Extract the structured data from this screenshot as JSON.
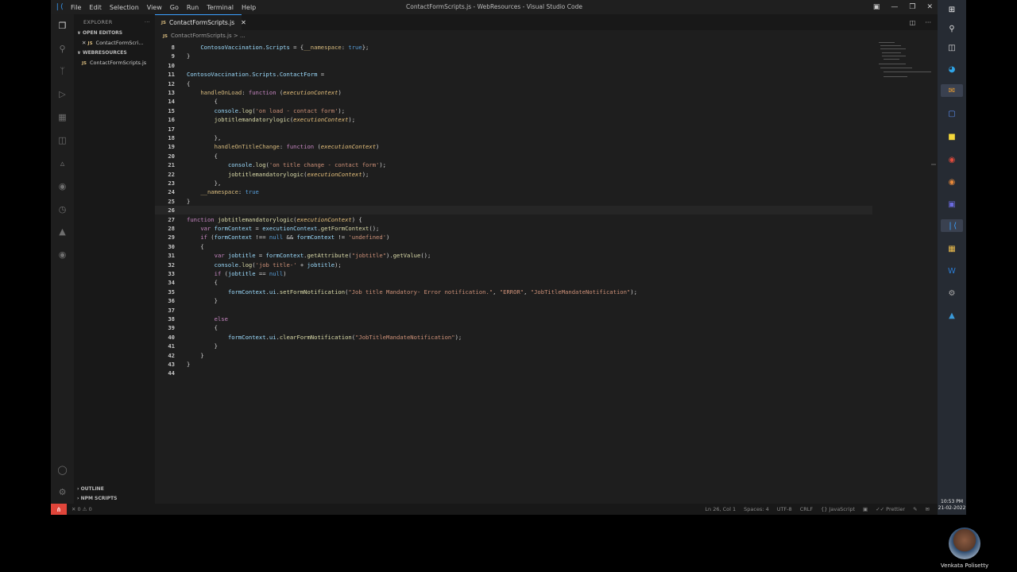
{
  "window": {
    "title": "ContactFormScripts.js - WebResources - Visual Studio Code",
    "menu": [
      "File",
      "Edit",
      "Selection",
      "View",
      "Go",
      "Run",
      "Terminal",
      "Help"
    ]
  },
  "sidebar": {
    "header": "EXPLORER",
    "open_editors_label": "OPEN EDITORS",
    "open_editor_item": "ContactFormScri...",
    "folder_label": "WEBRESOURCES",
    "folder_item": "ContactFormScripts.js",
    "outline_label": "OUTLINE",
    "npm_label": "NPM SCRIPTS"
  },
  "tab": {
    "label": "ContactFormScripts.js",
    "breadcrumb": "ContactFormScripts.js > ..."
  },
  "code_lines": [
    {
      "n": "8",
      "text": "    ContosoVaccination.Scripts = {__namespace: true};"
    },
    {
      "n": "9",
      "text": "}"
    },
    {
      "n": "10",
      "text": ""
    },
    {
      "n": "11",
      "text": "ContosoVaccination.Scripts.ContactForm ="
    },
    {
      "n": "12",
      "text": "{"
    },
    {
      "n": "13",
      "text": "    handleOnLoad: function (executionContext)"
    },
    {
      "n": "14",
      "text": "        {"
    },
    {
      "n": "15",
      "text": "        console.log('on load - contact form');"
    },
    {
      "n": "16",
      "text": "        jobtitlemandatorylogic(executionContext);"
    },
    {
      "n": "17",
      "text": ""
    },
    {
      "n": "18",
      "text": "        },"
    },
    {
      "n": "19",
      "text": "        handleOnTitleChange: function (executionContext)"
    },
    {
      "n": "20",
      "text": "        {"
    },
    {
      "n": "21",
      "text": "            console.log('on title change - contact form');"
    },
    {
      "n": "22",
      "text": "            jobtitlemandatorylogic(executionContext);"
    },
    {
      "n": "23",
      "text": "        },"
    },
    {
      "n": "24",
      "text": "    __namespace: true"
    },
    {
      "n": "25",
      "text": "}"
    },
    {
      "n": "26",
      "text": ""
    },
    {
      "n": "27",
      "text": "function jobtitlemandatorylogic(executionContext) {"
    },
    {
      "n": "28",
      "text": "    var formContext = executionContext.getFormContext();"
    },
    {
      "n": "29",
      "text": "    if (formContext !== null && formContext != 'undefined')"
    },
    {
      "n": "30",
      "text": "    {"
    },
    {
      "n": "31",
      "text": "        var jobtitle = formContext.getAttribute(\"jobtitle\").getValue();"
    },
    {
      "n": "32",
      "text": "        console.log('job title-' + jobtitle);"
    },
    {
      "n": "33",
      "text": "        if (jobtitle == null)"
    },
    {
      "n": "34",
      "text": "        {"
    },
    {
      "n": "35",
      "text": "            formContext.ui.setFormNotification(\"Job title Mandatory- Error notification.\", \"ERROR\", \"JobTitleMandateNotification\");"
    },
    {
      "n": "36",
      "text": "        }"
    },
    {
      "n": "37",
      "text": ""
    },
    {
      "n": "38",
      "text": "        else"
    },
    {
      "n": "39",
      "text": "        {"
    },
    {
      "n": "40",
      "text": "            formContext.ui.clearFormNotification(\"JobTitleMandateNotification\");"
    },
    {
      "n": "41",
      "text": "        }"
    },
    {
      "n": "42",
      "text": "    }"
    },
    {
      "n": "43",
      "text": "}"
    },
    {
      "n": "44",
      "text": ""
    }
  ],
  "status": {
    "errors": "0",
    "warnings": "0",
    "position": "Ln 26, Col 1",
    "spaces": "Spaces: 4",
    "encoding": "UTF-8",
    "eol": "CRLF",
    "language": "JavaScript",
    "formatter": "Prettier",
    "remote_color": "#e0453a"
  },
  "clock": {
    "time": "10:53 PM",
    "date": "21-02-2022"
  },
  "webcam": {
    "name": "Venkata Polisetty"
  },
  "icons": {
    "activity": [
      "explorer-icon",
      "search-icon",
      "source-control-icon",
      "run-debug-icon",
      "extensions-icon",
      "remote-explorer-icon",
      "testing-icon",
      "docker-icon",
      "timeline-icon",
      "azure-icon",
      "github-icon"
    ],
    "taskbar": [
      "windows-start-icon",
      "search-icon",
      "task-view-icon",
      "edge-icon",
      "outlook-icon",
      "teams-icon",
      "sticky-notes-icon",
      "chrome-icon",
      "chrome-dev-icon",
      "teams-preview-icon",
      "vscode-icon",
      "file-explorer-icon",
      "word-icon",
      "settings-icon",
      "photos-icon"
    ]
  }
}
